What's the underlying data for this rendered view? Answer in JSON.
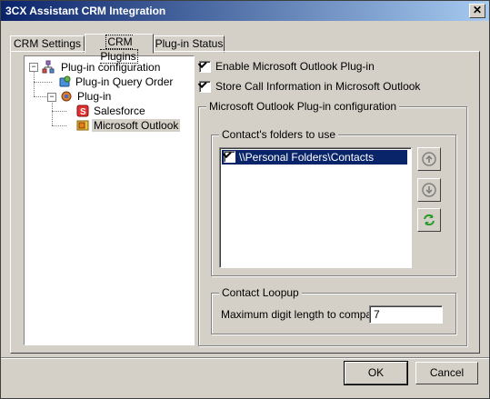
{
  "window": {
    "title": "3CX Assistant CRM Integration",
    "close_glyph": "✕"
  },
  "tabs": [
    {
      "label": "CRM Settings"
    },
    {
      "label": "CRM Plugins"
    },
    {
      "label": "Plug-in Status"
    }
  ],
  "tree": {
    "root": {
      "label": "Plug-in configuration",
      "expander": "−"
    },
    "query_order": {
      "label": "Plug-in Query Order"
    },
    "plugin": {
      "label": "Plug-in",
      "expander": "−"
    },
    "salesforce": {
      "label": "Salesforce"
    },
    "outlook": {
      "label": "Microsoft Outlook"
    }
  },
  "options": {
    "enable_outlook": {
      "label": "Enable Microsoft Outlook Plug-in",
      "checked": true
    },
    "store_call_info": {
      "label": "Store Call Information in Microsoft Outlook",
      "checked": true
    }
  },
  "outlook_config": {
    "title": "Microsoft Outlook Plug-in configuration",
    "folders": {
      "title": "Contact's folders to use",
      "items": [
        {
          "label": "\\\\Personal Folders\\Contacts",
          "checked": true
        }
      ]
    },
    "loopup": {
      "title": "Contact Loopup",
      "max_digit_label": "Maximum digit length to compare",
      "max_digit_value": "7"
    }
  },
  "footer": {
    "ok_label": "OK",
    "cancel_label": "Cancel"
  }
}
